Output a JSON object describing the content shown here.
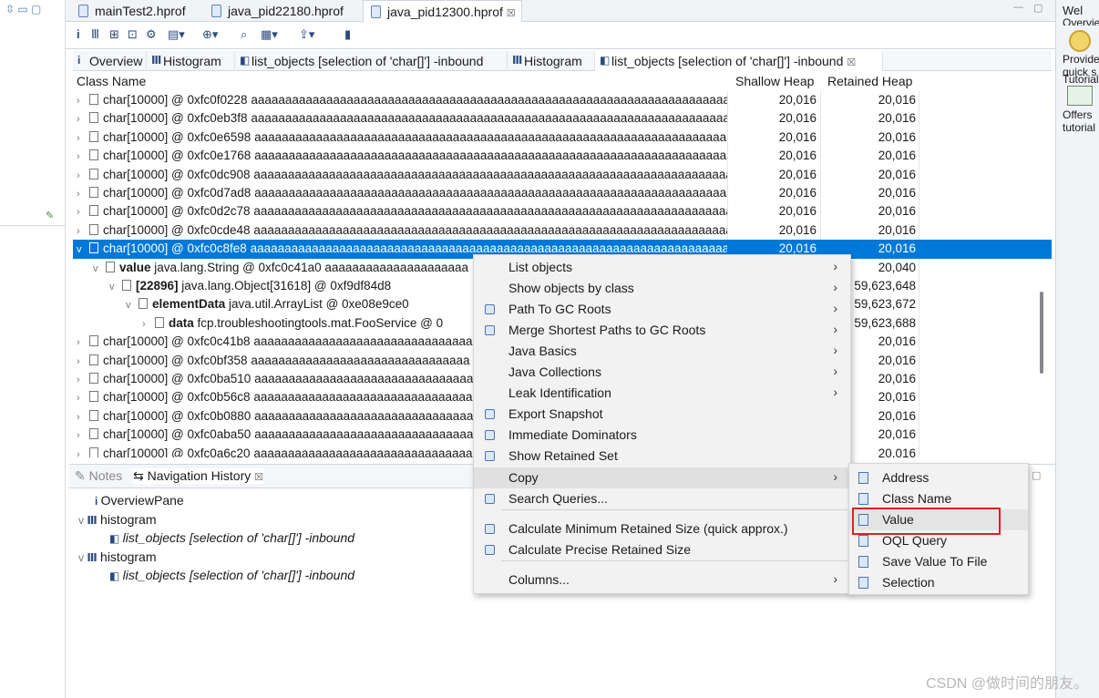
{
  "file_tabs": [
    "mainTest2.hprof",
    "java_pid22180.hprof",
    "java_pid12300.hprof"
  ],
  "close_glyph": "☒",
  "editor_tabs": [
    {
      "icon": "i",
      "label": "Overview"
    },
    {
      "icon": "Ⅲ",
      "label": "Histogram"
    },
    {
      "icon": "◧",
      "label": "list_objects  [selection of 'char[]'] -inbound"
    },
    {
      "icon": "Ⅲ",
      "label": "Histogram"
    },
    {
      "icon": "◧",
      "label": "list_objects  [selection of 'char[]'] -inbound"
    }
  ],
  "table": {
    "headers": [
      "Class Name",
      "Shallow Heap",
      "Retained Heap"
    ],
    "rows": [
      {
        "name": "char[10000] @ 0xfc0f0228",
        "value": "aaaaaaaaaaaaaaaaaaaaaaaaaaaaaaaaaaaaaaaaaaaaaaaaaaaaaaaaaaaaaaaaaaaaaaaaa",
        "shallow": "20,016",
        "retained": "20,016"
      },
      {
        "name": "char[10000] @ 0xfc0eb3f8",
        "value": "aaaaaaaaaaaaaaaaaaaaaaaaaaaaaaaaaaaaaaaaaaaaaaaaaaaaaaaaaaaaaaaaaaaaaaaaa",
        "shallow": "20,016",
        "retained": "20,016"
      },
      {
        "name": "char[10000] @ 0xfc0e6598",
        "value": "aaaaaaaaaaaaaaaaaaaaaaaaaaaaaaaaaaaaaaaaaaaaaaaaaaaaaaaaaaaaaaaaaaaaaaaaa",
        "shallow": "20,016",
        "retained": "20,016"
      },
      {
        "name": "char[10000] @ 0xfc0e1768",
        "value": "aaaaaaaaaaaaaaaaaaaaaaaaaaaaaaaaaaaaaaaaaaaaaaaaaaaaaaaaaaaaaaaaaaaaaaaaa",
        "shallow": "20,016",
        "retained": "20,016"
      },
      {
        "name": "char[10000] @ 0xfc0dc908",
        "value": "aaaaaaaaaaaaaaaaaaaaaaaaaaaaaaaaaaaaaaaaaaaaaaaaaaaaaaaaaaaaaaaaaaaaaaaaa",
        "shallow": "20,016",
        "retained": "20,016"
      },
      {
        "name": "char[10000] @ 0xfc0d7ad8",
        "value": "aaaaaaaaaaaaaaaaaaaaaaaaaaaaaaaaaaaaaaaaaaaaaaaaaaaaaaaaaaaaaaaaaaaaaaaaa",
        "shallow": "20,016",
        "retained": "20,016"
      },
      {
        "name": "char[10000] @ 0xfc0d2c78",
        "value": "aaaaaaaaaaaaaaaaaaaaaaaaaaaaaaaaaaaaaaaaaaaaaaaaaaaaaaaaaaaaaaaaaaaaaaaaa",
        "shallow": "20,016",
        "retained": "20,016"
      },
      {
        "name": "char[10000] @ 0xfc0cde48",
        "value": "aaaaaaaaaaaaaaaaaaaaaaaaaaaaaaaaaaaaaaaaaaaaaaaaaaaaaaaaaaaaaaaaaaaaaaaaa",
        "shallow": "20,016",
        "retained": "20,016"
      },
      {
        "name": "char[10000] @ 0xfc0c8fe8",
        "value": "aaaaaaaaaaaaaaaaaaaaaaaaaaaaaaaaaaaaaaaaaaaaaaaaaaaaaaaaaaaaaaaaaaaaaaaaa",
        "shallow": "20,016",
        "retained": "20,016",
        "selected": true
      },
      {
        "bold": "value",
        "name": "java.lang.String @ 0xfc0c41a0",
        "value": "aaaaaaaaaaaaaaaaaaaaa",
        "shallow": "",
        "retained": "20,040"
      },
      {
        "bold": "[22896]",
        "name": "java.lang.Object[31618] @ 0xf9df84d8",
        "value": "",
        "shallow": "",
        "retained": "59,623,648"
      },
      {
        "bold": "elementData",
        "name": "java.util.ArrayList @ 0xe08e9ce0",
        "value": "",
        "shallow": "",
        "retained": "59,623,672"
      },
      {
        "bold": "data",
        "name": "fcp.troubleshootingtools.mat.FooService @ 0",
        "value": "",
        "shallow": "",
        "retained": "59,623,688"
      },
      {
        "name": "char[10000] @ 0xfc0c41b8",
        "value": "aaaaaaaaaaaaaaaaaaaaaaaaaaaaaaaa",
        "shallow": "",
        "retained": "20,016"
      },
      {
        "name": "char[10000] @ 0xfc0bf358",
        "value": "aaaaaaaaaaaaaaaaaaaaaaaaaaaaaaaa",
        "shallow": "",
        "retained": "20,016"
      },
      {
        "name": "char[10000] @ 0xfc0ba510",
        "value": "aaaaaaaaaaaaaaaaaaaaaaaaaaaaaaaa",
        "shallow": "",
        "retained": "20,016"
      },
      {
        "name": "char[10000] @ 0xfc0b56c8",
        "value": "aaaaaaaaaaaaaaaaaaaaaaaaaaaaaaaa",
        "shallow": "",
        "retained": "20,016"
      },
      {
        "name": "char[10000] @ 0xfc0b0880",
        "value": "aaaaaaaaaaaaaaaaaaaaaaaaaaaaaaaa",
        "shallow": "",
        "retained": "20,016"
      },
      {
        "name": "char[10000] @ 0xfc0aba50",
        "value": "aaaaaaaaaaaaaaaaaaaaaaaaaaaaaaaa",
        "shallow": "",
        "retained": "20,016"
      },
      {
        "name": "char[10000] @ 0xfc0a6c20",
        "value": "aaaaaaaaaaaaaaaaaaaaaaaaaaaaaaaa",
        "shallow": "",
        "retained": "20,016"
      }
    ]
  },
  "context_menu": {
    "items": [
      {
        "label": "List objects",
        "submenu": true,
        "icon": false
      },
      {
        "label": "Show objects by class",
        "submenu": true,
        "icon": false
      },
      {
        "label": "Path To GC Roots",
        "submenu": true,
        "icon": true
      },
      {
        "label": "Merge Shortest Paths to GC Roots",
        "submenu": true,
        "icon": true
      },
      {
        "label": "Java Basics",
        "submenu": true,
        "icon": false
      },
      {
        "label": "Java Collections",
        "submenu": true,
        "icon": false
      },
      {
        "label": "Leak Identification",
        "submenu": true,
        "icon": false
      },
      {
        "label": "Export Snapshot",
        "submenu": false,
        "icon": true
      },
      {
        "label": "Immediate Dominators",
        "submenu": false,
        "icon": true
      },
      {
        "label": "Show Retained Set",
        "submenu": false,
        "icon": true
      },
      {
        "label": "Copy",
        "submenu": true,
        "icon": false,
        "hover": true
      },
      {
        "label": "Search Queries...",
        "submenu": false,
        "icon": true
      },
      {
        "label": "Calculate Minimum Retained Size (quick approx.)",
        "submenu": false,
        "icon": true
      },
      {
        "label": "Calculate Precise Retained Size",
        "submenu": false,
        "icon": true
      },
      {
        "label": "Columns...",
        "submenu": true,
        "icon": false
      }
    ],
    "submenu_glyph": "›"
  },
  "copy_submenu": [
    "Address",
    "Class Name",
    "Value",
    "OQL Query",
    "Save Value To File",
    "Selection"
  ],
  "lower": {
    "tabs": [
      "Notes",
      "Navigation History"
    ],
    "history": [
      {
        "icon": "i",
        "label": "OverviewPane",
        "italic": false
      },
      {
        "icon": "Ⅲ",
        "label": "histogram",
        "italic": false,
        "expand": "v"
      },
      {
        "icon": "◧",
        "label": "list_objects  [selection of 'char[]'] -inbound",
        "italic": true
      },
      {
        "icon": "Ⅲ",
        "label": "histogram",
        "italic": false,
        "expand": "v"
      },
      {
        "icon": "◧",
        "label": "list_objects  [selection of 'char[]'] -inbound",
        "italic": true
      }
    ]
  },
  "right_panel": [
    "Wel",
    "Overvie",
    "Provide",
    "quick s",
    "Tutorial",
    "Offers",
    "tutorial"
  ],
  "watermark": "CSDN @做时间的朋友。"
}
